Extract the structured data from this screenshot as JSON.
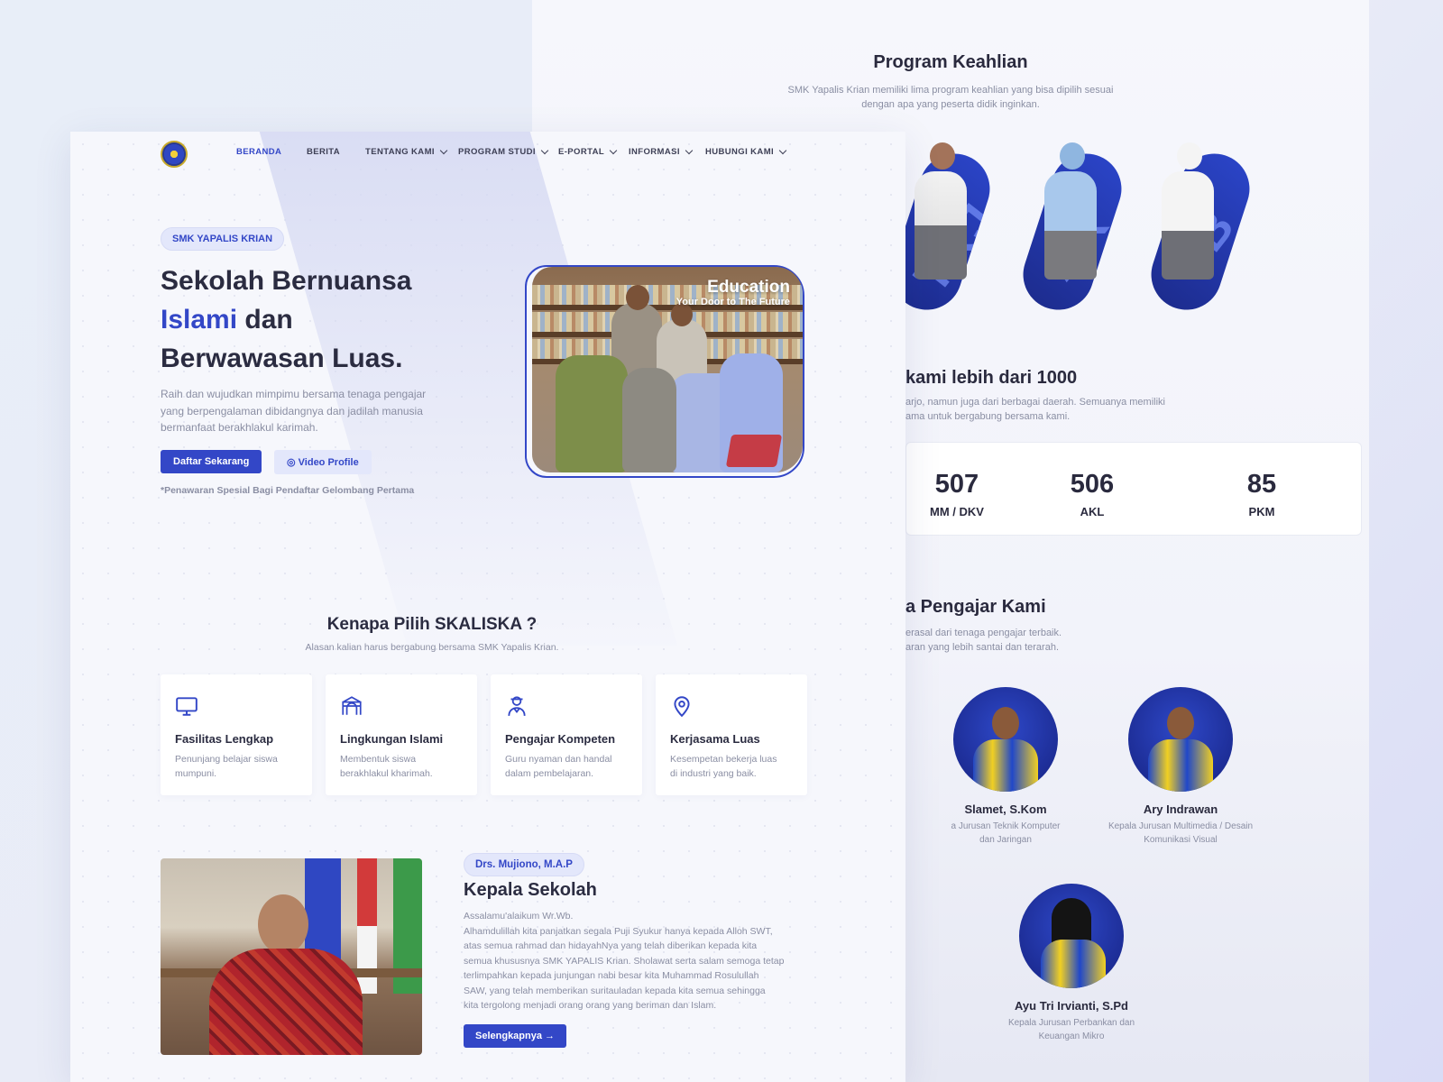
{
  "program": {
    "title": "Program Keahlian",
    "subtitle_line1": "SMK Yapalis Krian memiliki lima program keahlian yang bisa dipilih sesuai",
    "subtitle_line2": "dengan apa yang peserta didik inginkan.",
    "cards": [
      {
        "code": "TKJ",
        "color": "#8ba2ff"
      },
      {
        "code": "AK",
        "color": "#8ba2ff"
      },
      {
        "code": "PB",
        "color": "#8ba2ff"
      }
    ]
  },
  "students": {
    "title": "kami lebih dari 1000",
    "subtitle_line1": "arjo, namun juga dari berbagai daerah. Semuanya memiliki",
    "subtitle_line2": "ama untuk bergabung bersama kami."
  },
  "stats": [
    {
      "value": "507",
      "label": "MM / DKV"
    },
    {
      "value": "506",
      "label": "AKL"
    },
    {
      "value": "85",
      "label": "PKM"
    }
  ],
  "teachers": {
    "title": "a Pengajar Kami",
    "subtitle_line1": "erasal dari tenaga pengajar terbaik.",
    "subtitle_line2": "aran yang lebih santai dan terarah.",
    "list": [
      {
        "name": "Slamet, S.Kom",
        "role_line1": "a Jurusan Teknik Komputer",
        "role_line2": "dan Jaringan"
      },
      {
        "name": "Ary Indrawan",
        "role_line1": "Kepala Jurusan Multimedia / Desain",
        "role_line2": "Komunikasi Visual"
      },
      {
        "name": "Ayu Tri Irvianti, S.Pd",
        "role_line1": "Kepala Jurusan Perbankan dan",
        "role_line2": "Keuangan Mikro"
      }
    ]
  },
  "nav": {
    "items": [
      "BERANDA",
      "BERITA",
      "TENTANG KAMI",
      "PROGRAM STUDI",
      "E-PORTAL",
      "INFORMASI",
      "HUBUNGI KAMI"
    ]
  },
  "hero": {
    "badge": "SMK YAPALIS KRIAN",
    "title_line1": "Sekolah Bernuansa",
    "title_highlight": "Islami",
    "title_line2_rest": " dan",
    "title_line3": "Berwawasan Luas.",
    "desc_line1": "Raih dan wujudkan mimpimu bersama tenaga pengajar",
    "desc_line2": "yang berpengalaman dibidangnya dan jadilah manusia",
    "desc_line3": "bermanfaat berakhlakul karimah.",
    "cta_primary": "Daftar Sekarang",
    "cta_secondary": "◎ Video Profile",
    "note": "*Penawaran Spesial Bagi Pendaftar Gelombang Pertama",
    "image_title": "Education",
    "image_subtitle": "Your Door to The Future"
  },
  "why": {
    "title": "Kenapa Pilih SKALISKA ?",
    "subtitle": "Alasan kalian harus bergabung bersama SMK Yapalis Krian.",
    "features": [
      {
        "icon": "monitor-icon",
        "title": "Fasilitas Lengkap",
        "desc_line1": "Penunjang belajar siswa",
        "desc_line2": "mumpuni."
      },
      {
        "icon": "mosque-icon",
        "title": "Lingkungan Islami",
        "desc_line1": "Membentuk siswa",
        "desc_line2": "berakhlakul kharimah."
      },
      {
        "icon": "teacher-icon",
        "title": "Pengajar Kompeten",
        "desc_line1": "Guru nyaman dan handal",
        "desc_line2": "dalam pembelajaran."
      },
      {
        "icon": "map-pin-icon",
        "title": "Kerjasama Luas",
        "desc_line1": "Kesempetan bekerja luas",
        "desc_line2": "di industri yang baik."
      }
    ]
  },
  "principal": {
    "badge": "Drs. Mujiono, M.A.P",
    "title": "Kepala Sekolah",
    "lines": [
      "Assalamu'alaikum Wr.Wb.",
      "Alhamdulillah kita panjatkan segala Puji Syukur hanya kepada Alloh SWT,",
      "atas semua rahmad dan hidayahNya yang telah diberikan kepada kita",
      "semua khususnya SMK YAPALIS Krian. Sholawat serta salam semoga tetap",
      "terlimpahkan kepada junjungan nabi besar kita Muhammad Rosulullah",
      "SAW, yang telah memberikan suritauladan kepada kita semua sehingga",
      "kita tergolong menjadi orang orang yang beriman dan Islam."
    ],
    "cta": "Selengkapnya →"
  },
  "colors": {
    "accent": "#3347c7",
    "text": "#2b2c41",
    "muted": "#8a8ea3"
  }
}
